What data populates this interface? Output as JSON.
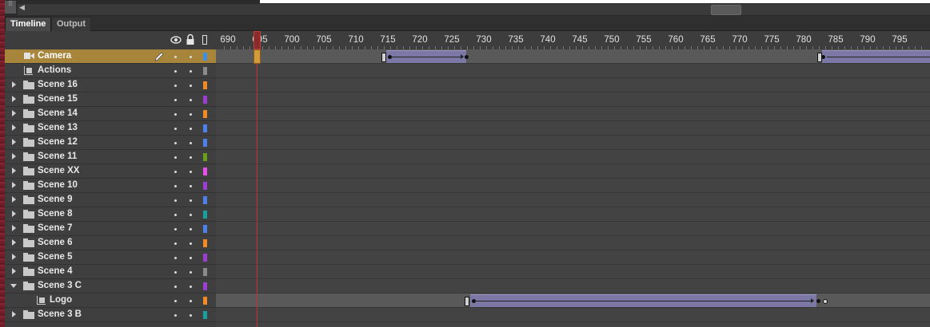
{
  "tabs": {
    "timeline": "Timeline",
    "output": "Output"
  },
  "ruler_labels": [
    "690",
    "695",
    "700",
    "705",
    "710",
    "715",
    "720",
    "725",
    "730",
    "735",
    "740",
    "745",
    "750",
    "755",
    "760",
    "765",
    "770",
    "775",
    "780",
    "785",
    "790",
    "795"
  ],
  "layers": [
    {
      "name": "Camera",
      "type": "camera",
      "selected": true,
      "color": "#3d8fe0",
      "pencil": true
    },
    {
      "name": "Actions",
      "type": "layer",
      "color": "#8c8c8c"
    },
    {
      "name": "Scene 16",
      "type": "folder",
      "color": "#f08a24"
    },
    {
      "name": "Scene 15",
      "type": "folder",
      "color": "#9b3fd1"
    },
    {
      "name": "Scene 14",
      "type": "folder",
      "color": "#f08a24"
    },
    {
      "name": "Scene 13",
      "type": "folder",
      "color": "#4f7fe8"
    },
    {
      "name": "Scene 12",
      "type": "folder",
      "color": "#4f7fe8"
    },
    {
      "name": "Scene 11",
      "type": "folder",
      "color": "#6a9e1a"
    },
    {
      "name": "Scene XX",
      "type": "folder",
      "color": "#e64fe6"
    },
    {
      "name": "Scene 10",
      "type": "folder",
      "color": "#9b3fd1"
    },
    {
      "name": "Scene 9",
      "type": "folder",
      "color": "#4f7fe8"
    },
    {
      "name": "Scene 8",
      "type": "folder",
      "color": "#1a9e9e"
    },
    {
      "name": "Scene 7",
      "type": "folder",
      "color": "#4f7fe8"
    },
    {
      "name": "Scene 6",
      "type": "folder",
      "color": "#f08a24"
    },
    {
      "name": "Scene 5",
      "type": "folder",
      "color": "#9b3fd1"
    },
    {
      "name": "Scene 4",
      "type": "folder",
      "color": "#8c8c8c"
    },
    {
      "name": "Scene 3 C",
      "type": "folder-open",
      "color": "#9b3fd1"
    },
    {
      "name": "Logo",
      "type": "layer-inner",
      "color": "#f08a24"
    },
    {
      "name": "Scene 3 B",
      "type": "folder",
      "color": "#1a9e9e"
    }
  ],
  "colors": {
    "selected_row": "#a7853b",
    "tween": "#7b78a6",
    "playhead": "#c83030"
  }
}
